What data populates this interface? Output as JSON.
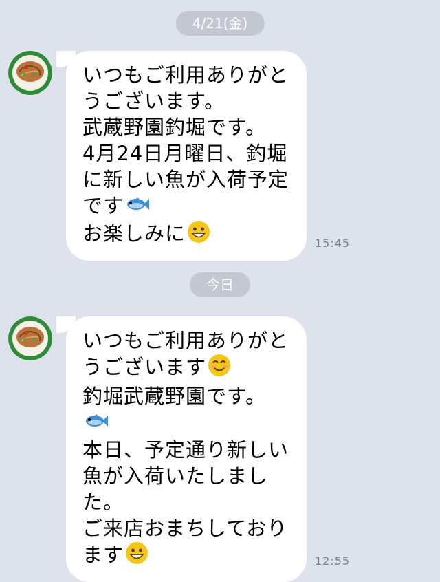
{
  "date_separators": [
    "4/21(金)",
    "今日"
  ],
  "messages": [
    {
      "lines": [
        "いつもご利用ありがと",
        "うございます。",
        "武蔵野園釣堀です。",
        "4月24日月曜日、釣堀",
        "に新しい魚が入荷予定",
        "です",
        "お楽しみに"
      ],
      "emojis": [
        "fish-emoji",
        "grinning-face-emoji"
      ],
      "time": "15:45"
    },
    {
      "lines": [
        "いつもご利用ありがと",
        "うございます",
        "釣堀武蔵野園です。",
        "本日、予定通り新しい",
        "魚が入荷いたしまし",
        "た。",
        "ご来店おまちしており",
        "ます"
      ],
      "emojis": [
        "smiling-face-emoji",
        "fish-emoji",
        "grinning-face-emoji"
      ],
      "time": "12:55"
    }
  ],
  "avatar": {
    "icon": "food-plate-avatar-icon"
  },
  "colors": {
    "background": "#dde2ec",
    "bubble": "#ffffff",
    "pill": "#c3c8d2"
  }
}
